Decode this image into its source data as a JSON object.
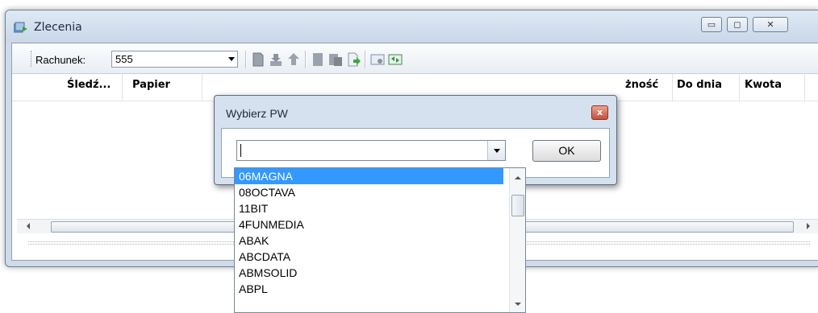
{
  "window": {
    "title": "Zlecenia",
    "controls": {
      "minimize": "▭",
      "maximize": "◻",
      "close": "✕"
    }
  },
  "toolbar": {
    "rachunek_label": "Rachunek:",
    "rachunek_value": "555"
  },
  "grid": {
    "columns": [
      "Śledź...",
      "Papier",
      "",
      "",
      "",
      "",
      "",
      "",
      "",
      "żność",
      "Do dnia",
      "Kwota"
    ]
  },
  "dialog": {
    "title": "Wybierz PW",
    "close": "x",
    "input_value": "",
    "ok_label": "OK"
  },
  "dropdown": {
    "items": [
      "06MAGNA",
      "08OCTAVA",
      "11BIT",
      "4FUNMEDIA",
      "ABAK",
      "ABCDATA",
      "ABMSOLID",
      "ABPL"
    ],
    "selected_index": 0
  },
  "colors": {
    "selection": "#3399ff",
    "window_frame": "#cfdbe9",
    "dialog_frame": "#d5e1ef"
  }
}
